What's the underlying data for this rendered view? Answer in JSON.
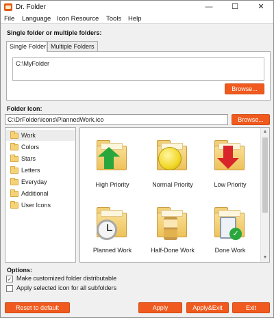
{
  "window": {
    "title": "Dr. Folder",
    "min_glyph": "—",
    "max_glyph": "☐",
    "close_glyph": "✕"
  },
  "menu": [
    "File",
    "Language",
    "Icon Resource",
    "Tools",
    "Help"
  ],
  "source": {
    "heading": "Single folder or multiple folders:",
    "tabs": [
      "Single Folder",
      "Multiple Folders"
    ],
    "active_tab": "Single Folder",
    "folder_value": "C:\\MyFolder",
    "browse_label": "Browse..."
  },
  "icon": {
    "heading": "Folder Icon:",
    "path_value": "C:\\DrFolder\\icons\\PlannedWork.ico",
    "browse_label": "Browse..."
  },
  "categories": [
    "Work",
    "Colors",
    "Stars",
    "Letters",
    "Everyday",
    "Additional",
    "User Icons"
  ],
  "selected_category": "Work",
  "icons": [
    {
      "label": "High Priority",
      "overlay": "arrow-up-green"
    },
    {
      "label": "Normal Priority",
      "overlay": "circle-yellow"
    },
    {
      "label": "Low Priority",
      "overlay": "arrow-down-red"
    },
    {
      "label": "Planned Work",
      "overlay": "alarm-clock"
    },
    {
      "label": "Half-Done Work",
      "overlay": "hourglass"
    },
    {
      "label": "Done Work",
      "overlay": "clipboard-check"
    }
  ],
  "options": {
    "heading": "Options:",
    "items": [
      {
        "label": "Make customized folder distributable",
        "checked": true,
        "mark": "✓"
      },
      {
        "label": "Apply selected icon for all subfolders",
        "checked": false,
        "mark": ""
      }
    ]
  },
  "footer": {
    "reset_label": "Reset to default",
    "apply_label": "Apply",
    "apply_exit_label": "Apply&Exit",
    "exit_label": "Exit"
  },
  "colors": {
    "accent": "#f05a1e",
    "folder": "#f2cf74"
  }
}
